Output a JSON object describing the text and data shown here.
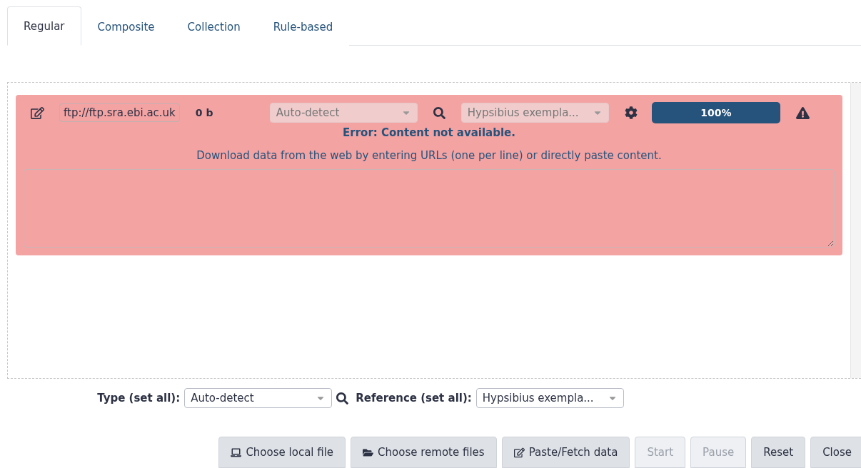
{
  "tabs": [
    {
      "label": "Regular",
      "selected": true
    },
    {
      "label": "Composite",
      "selected": false
    },
    {
      "label": "Collection",
      "selected": false
    },
    {
      "label": "Rule-based",
      "selected": false
    }
  ],
  "uploads": [
    {
      "failed": true,
      "url": "ftp://ftp.sra.ebi.ac.uk",
      "size": "0 b",
      "type": "Auto-detect",
      "reference": "Hypsibius exempla...",
      "selects_disabled": true,
      "progress": {
        "level": 1,
        "text": "100%"
      },
      "message": "Error: Content not available.",
      "hint": "Download data from the web by entering URLs (one per line) or directly paste content."
    }
  ],
  "set_all": {
    "type_label": "Type (set all):",
    "type": "Auto-detect",
    "reference_label": "Reference (set all):",
    "reference": "Hypsibius exempla..."
  },
  "buttons": [
    {
      "label": "Choose local file",
      "disabled": false
    },
    {
      "label": "Choose remote files",
      "disabled": false
    },
    {
      "label": "Paste/Fetch data",
      "disabled": false
    },
    {
      "label": "Start",
      "disabled": true
    },
    {
      "label": "Pause",
      "disabled": true
    },
    {
      "label": "Reset",
      "disabled": false
    },
    {
      "label": "Close",
      "disabled": false
    }
  ]
}
